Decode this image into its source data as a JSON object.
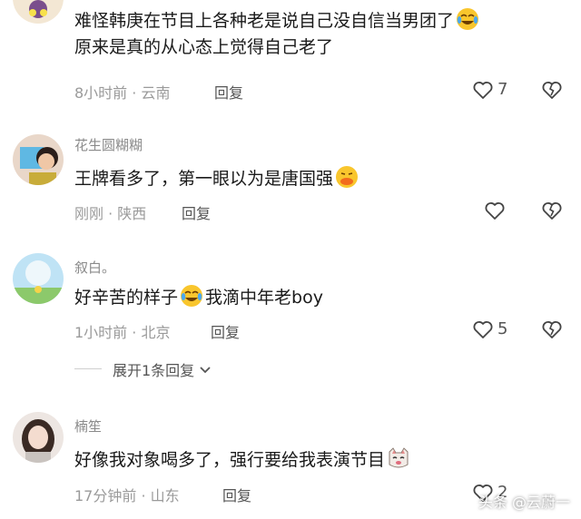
{
  "comments": [
    {
      "lines": [
        "难怪韩庚在节目上各种老是说自己没自信当男团了",
        "原来是真的从心态上觉得自己老了"
      ],
      "emoji": "laugh-cry-emoji",
      "time": "8小时前",
      "location": "云南",
      "reply": "回复",
      "likes": "7"
    },
    {
      "username": "花生圆糊糊",
      "text": "王牌看多了，第一眼以为是唐国强",
      "emoji": "duck-lips-emoji",
      "time": "刚刚",
      "location": "陕西",
      "reply": "回复"
    },
    {
      "username": "叙白。",
      "text_before": "好辛苦的样子",
      "emoji": "laugh-cry-emoji",
      "text_after": "我滴中年老boy",
      "time": "1小时前",
      "location": "北京",
      "reply": "回复",
      "likes": "5",
      "expand": "展开1条回复"
    },
    {
      "username": "楠笙",
      "text": "好像我对象喝多了，强行要给我表演节目",
      "emoji": "cat-face-emoji",
      "time": "17分钟前",
      "location": "山东",
      "reply": "回复",
      "likes": "2"
    }
  ],
  "watermark": "头条 @云蔚一",
  "colors": {
    "text": "#1a1a1a",
    "meta": "#9a9a9a",
    "username": "#8a8a8a",
    "background": "#ffffff"
  }
}
